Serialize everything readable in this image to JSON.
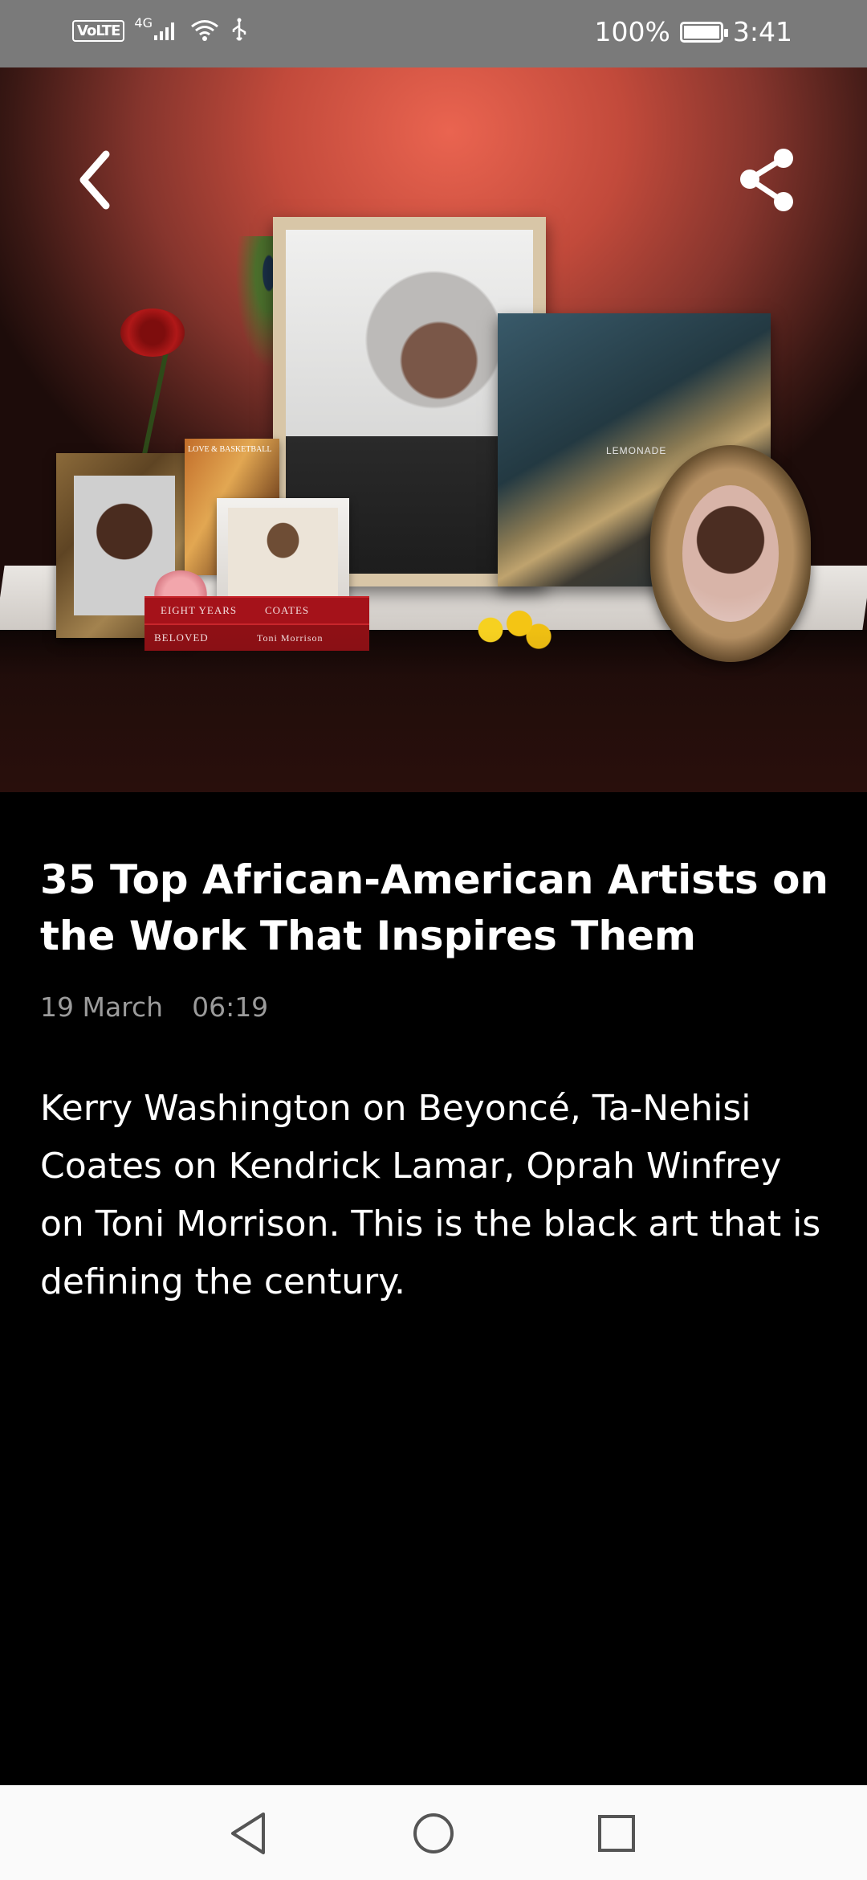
{
  "status_bar": {
    "volte": "VoLTE",
    "network": "4G",
    "battery": "100%",
    "time": "3:41"
  },
  "hero": {
    "album_label": "LEMONADE",
    "book_top_left": "EIGHT YEARS",
    "book_top_right": "COATES",
    "book_bottom_left": "BELOVED",
    "book_bottom_right": "Toni Morrison",
    "dvd_label": "LOVE & BASKETBALL",
    "icons": {
      "back": "chevron-left-icon",
      "share": "share-icon"
    }
  },
  "article": {
    "title": "35 Top African-American Artists on the Work That Inspires Them",
    "date": "19 March",
    "time": "06:19",
    "summary": "Kerry Washington on Beyoncé, Ta-Nehisi Coates on Kendrick Lamar, Oprah Winfrey on Toni Morrison. This is the black art that is defining the century."
  },
  "nav": {
    "icons": {
      "back": "triangle-back-icon",
      "home": "circle-home-icon",
      "recents": "square-recents-icon"
    }
  },
  "colors": {
    "status_bar_bg": "#7a7a7a",
    "page_bg": "#000000",
    "meta_text": "#9b9b9b",
    "nav_bar_bg": "#fafafa"
  }
}
